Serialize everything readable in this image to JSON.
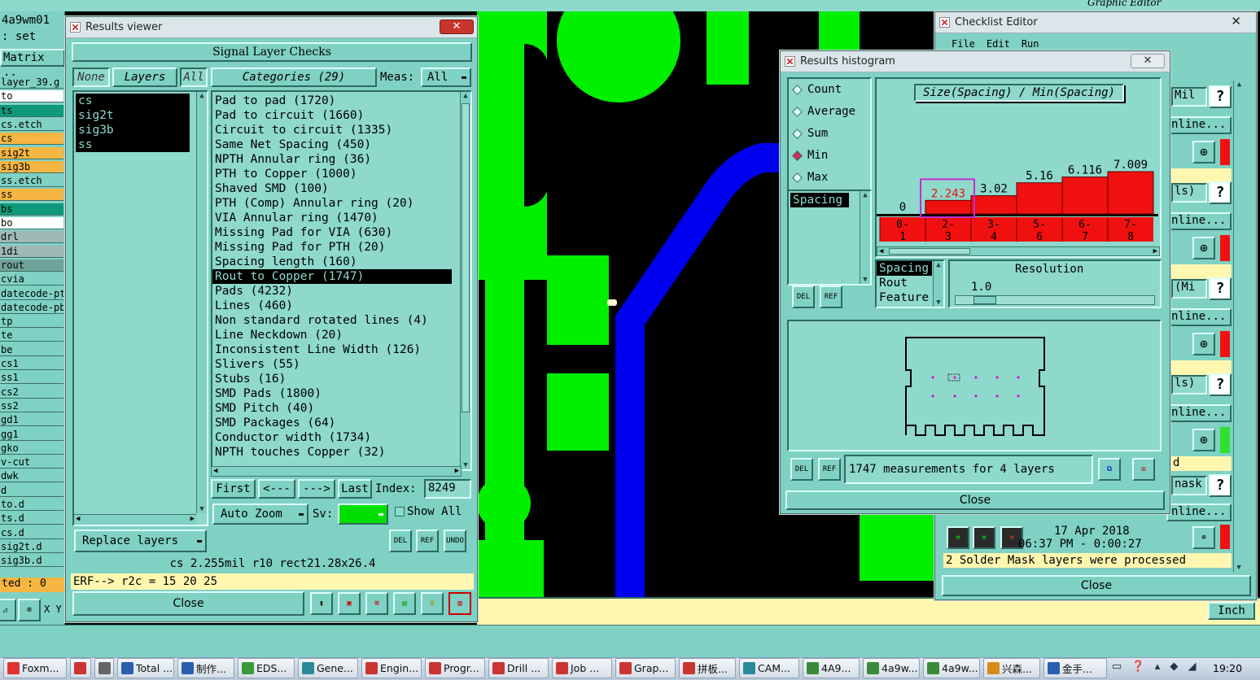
{
  "left_panel": {
    "header1": "4a9wm01",
    "header2": ": set",
    "header3": "Matrix ..",
    "rows": [
      {
        "label": "layer_39.g",
        "bg": "#7fd1c4"
      },
      {
        "label": "to",
        "bg": "#ffffff"
      },
      {
        "label": "ts",
        "bg": "#0e9a7a"
      },
      {
        "label": "cs.etch",
        "bg": "#7fd1c4"
      },
      {
        "label": "cs",
        "bg": "#f5b642"
      },
      {
        "label": "sig2t",
        "bg": "#f5b642"
      },
      {
        "label": "sig3b",
        "bg": "#f5b642"
      },
      {
        "label": "ss.etch",
        "bg": "#7fd1c4"
      },
      {
        "label": "ss",
        "bg": "#f5b642"
      },
      {
        "label": "bs",
        "bg": "#0e9a7a"
      },
      {
        "label": "bo",
        "bg": "#ffffff"
      },
      {
        "label": "drl",
        "bg": "#9fb8b4"
      },
      {
        "label": "1di",
        "bg": "#9fb8b4"
      },
      {
        "label": "rout",
        "bg": "#6fa39a"
      },
      {
        "label": "cvia",
        "bg": "#7fd1c4"
      },
      {
        "label": "datecode-pt",
        "bg": "#7fd1c4"
      },
      {
        "label": "datecode-pb",
        "bg": "#7fd1c4"
      },
      {
        "label": "tp",
        "bg": "#7fd1c4"
      },
      {
        "label": "te",
        "bg": "#7fd1c4"
      },
      {
        "label": "be",
        "bg": "#7fd1c4"
      },
      {
        "label": "cs1",
        "bg": "#7fd1c4"
      },
      {
        "label": "ss1",
        "bg": "#7fd1c4"
      },
      {
        "label": "cs2",
        "bg": "#7fd1c4"
      },
      {
        "label": "ss2",
        "bg": "#7fd1c4"
      },
      {
        "label": "gd1",
        "bg": "#7fd1c4"
      },
      {
        "label": "gg1",
        "bg": "#7fd1c4"
      },
      {
        "label": "gko",
        "bg": "#7fd1c4"
      },
      {
        "label": "v-cut",
        "bg": "#7fd1c4"
      },
      {
        "label": "dwk",
        "bg": "#7fd1c4"
      },
      {
        "label": "d",
        "bg": "#7fd1c4"
      },
      {
        "label": "to.d",
        "bg": "#7fd1c4"
      },
      {
        "label": "ts.d",
        "bg": "#7fd1c4"
      },
      {
        "label": "cs.d",
        "bg": "#7fd1c4"
      },
      {
        "label": "sig2t.d",
        "bg": "#7fd1c4"
      },
      {
        "label": "sig3b.d",
        "bg": "#7fd1c4"
      }
    ],
    "footer": "ted : 0",
    "xy_label": "X Y"
  },
  "results_viewer": {
    "title": "Results viewer",
    "section_title": "Signal Layer Checks",
    "filter_none": "None",
    "filter_layers": "Layers",
    "filter_all": "All",
    "categories_label": "Categories (29)",
    "meas_label": "Meas:",
    "meas_value": "All",
    "layers": [
      "cs",
      "sig2t",
      "sig3b",
      "ss"
    ],
    "categories": [
      "Pad to pad (1720)",
      "Pad to circuit (1660)",
      "Circuit to circuit (1335)",
      "Same Net Spacing (450)",
      "NPTH Annular ring (36)",
      "PTH to Copper (1000)",
      "Shaved SMD (100)",
      "PTH (Comp) Annular ring (20)",
      "VIA Annular ring (1470)",
      "Missing Pad for VIA (630)",
      "Missing Pad for PTH (20)",
      "Spacing length (160)",
      "Rout to Copper (1747)",
      "Pads (4232)",
      "Lines (460)",
      "Non standard rotated lines (4)",
      "Line Neckdown (20)",
      "Inconsistent Line Width (126)",
      "Slivers (55)",
      "Stubs (16)",
      "SMD Pads (1800)",
      "SMD Pitch (40)",
      "SMD Packages (64)",
      "Conductor width (1734)",
      "NPTH touches Copper (32)"
    ],
    "selected_category": "Rout to Copper (1747)",
    "nav": {
      "first": "First",
      "prev": "<---",
      "next": "--->",
      "last": "Last",
      "index_label": "Index:",
      "index_value": "8249"
    },
    "auto_zoom": "Auto Zoom",
    "sv_label": "Sv:",
    "show_all": "Show All",
    "replace_layers": "Replace layers",
    "del": "DEL",
    "ref": "REF",
    "undo": "UNDO",
    "info_line": "cs 2.255mil  r10  rect21.28x26.4",
    "erf_line": "ERF--> r2c = 15 20 25",
    "close": "Close"
  },
  "histogram": {
    "title": "Results histogram",
    "options": [
      "Count",
      "Average",
      "Sum",
      "Min",
      "Max"
    ],
    "selected_option": "Min",
    "chart_title": "Size(Spacing) / Min(Spacing)",
    "list_item": "Spacing",
    "selector_items": [
      "Spacing",
      "Rout",
      "Feature"
    ],
    "resolution_label": "Resolution",
    "resolution_value": "1.0",
    "measurements": "1747 measurements for 4 layers",
    "del": "DEL",
    "ref": "REF",
    "close": "Close"
  },
  "chart_data": {
    "type": "bar",
    "title": "Size(Spacing) / Min(Spacing)",
    "categories": [
      "0-1",
      "2-3",
      "3-4",
      "5-6",
      "6-7",
      "7-8"
    ],
    "category_lines": [
      [
        "0-",
        "1"
      ],
      [
        "2-",
        "3"
      ],
      [
        "3-",
        "4"
      ],
      [
        "5-",
        "6"
      ],
      [
        "6-",
        "7"
      ],
      [
        "7-",
        "8"
      ]
    ],
    "values": [
      0,
      2.243,
      3.02,
      5.16,
      6.116,
      7.009
    ],
    "value_labels": [
      "0",
      "2.243",
      "3.02",
      "5.16",
      "6.116",
      "7.009"
    ],
    "highlighted_index": 1,
    "bar_color": "#f01010",
    "ylim": [
      0,
      7.009
    ]
  },
  "checklist": {
    "title": "Checklist Editor",
    "menu": [
      "File",
      "Edit",
      "Run"
    ],
    "units": [
      "Mil",
      "ls)",
      "(Mi",
      "ls)"
    ],
    "online": "nline...",
    "field_d": "d",
    "mask": "nask",
    "date": "17 Apr 2018",
    "time": "06:37 PM - 0:00:27",
    "status": "2 Solder Mask layers were processed",
    "close": "Close"
  },
  "graphic_editor": {
    "title": "Graphic Editor",
    "inch": "Inch"
  },
  "taskbar": {
    "items": [
      {
        "label": "Foxm...",
        "color": "#d33"
      },
      {
        "label": "",
        "color": "#c33"
      },
      {
        "label": "",
        "color": "#666"
      },
      {
        "label": "Total ...",
        "color": "#2a5fb0"
      },
      {
        "label": "制作...",
        "color": "#2a5fb0"
      },
      {
        "label": "EDS...",
        "color": "#3a9a3a"
      },
      {
        "label": "Gene...",
        "color": "#2a8a9a"
      },
      {
        "label": "Engin...",
        "color": "#c33"
      },
      {
        "label": "Progr...",
        "color": "#c33"
      },
      {
        "label": "Drill ...",
        "color": "#c33"
      },
      {
        "label": "Job ...",
        "color": "#c33"
      },
      {
        "label": "Grap...",
        "color": "#c33"
      },
      {
        "label": "拼板...",
        "color": "#c33"
      },
      {
        "label": "CAM...",
        "color": "#2a8a9a"
      },
      {
        "label": "4A9...",
        "color": "#3a8a3a"
      },
      {
        "label": "4a9w...",
        "color": "#3a8a3a"
      },
      {
        "label": "4a9w...",
        "color": "#3a8a3a"
      },
      {
        "label": "兴森...",
        "color": "#d88a1a"
      },
      {
        "label": "金手...",
        "color": "#2a5fb0"
      }
    ],
    "clock": "19:20"
  }
}
